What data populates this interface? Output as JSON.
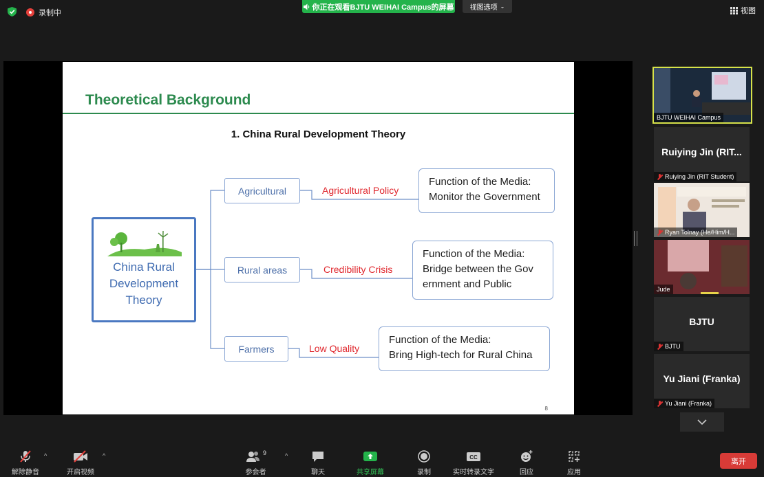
{
  "topbar": {
    "recording_label": "录制中",
    "share_banner": "你正在观看BJTU WEIHAI Campus的屏幕",
    "view_options": "视图选项",
    "view_button": "视图"
  },
  "slide": {
    "title": "Theoretical Background",
    "subtitle": "1. China Rural Development Theory",
    "page_number": "8",
    "center_box": [
      "China Rural",
      "Development",
      "Theory"
    ],
    "branches": [
      {
        "node": "Agricultural",
        "issue": "Agricultural Policy",
        "function": [
          "Function of the Media:",
          "Monitor the Government"
        ]
      },
      {
        "node": "Rural areas",
        "issue": "Credibility Crisis",
        "function": [
          "Function of the Media:",
          "Bridge between the Gov",
          "ernment and Public"
        ]
      },
      {
        "node": "Farmers",
        "issue": "Low Quality",
        "function": [
          "Function of the Media:",
          "Bring High-tech for Rural China"
        ]
      }
    ]
  },
  "participants": [
    {
      "name": "BJTU WEIHAI Campus",
      "big_name": "",
      "muted": false,
      "active": true
    },
    {
      "name": "Ruiying Jin (RIT Student)",
      "big_name": "Ruiying Jin (RIT...",
      "muted": true
    },
    {
      "name": "Ryan Tolnay (He/Him/H...",
      "big_name": "",
      "muted": true
    },
    {
      "name": "Jude",
      "big_name": "",
      "muted": false
    },
    {
      "name": "BJTU",
      "big_name": "BJTU",
      "muted": true
    },
    {
      "name": "Yu Jiani (Franka)",
      "big_name": "Yu Jiani (Franka)",
      "muted": true
    }
  ],
  "toolbar": {
    "unmute": "解除静音",
    "start_video": "开启视频",
    "participants": "参会者",
    "participants_count": "9",
    "chat": "聊天",
    "share_screen": "共享屏幕",
    "record": "录制",
    "captions": "实时转录文字",
    "reactions": "回应",
    "apps": "应用",
    "leave": "离开"
  },
  "colors": {
    "green_accent": "#24b34b",
    "slide_green": "#2c8a4e",
    "slide_blue": "#4a78c1",
    "slide_red": "#e0282e",
    "leave_red": "#d83b37",
    "active_speaker": "#d7e24a"
  }
}
